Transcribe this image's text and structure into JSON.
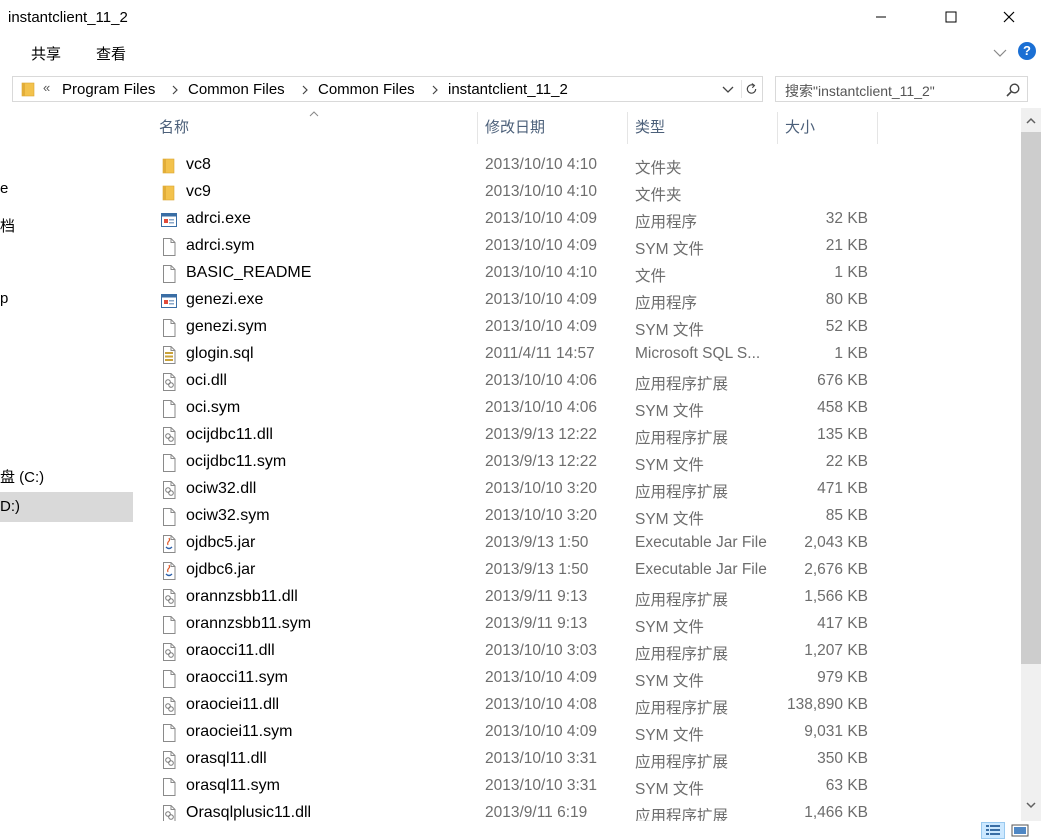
{
  "window": {
    "title": "instantclient_11_2",
    "minimize": "—",
    "maximize": "☐",
    "close": "✕"
  },
  "ribbon": {
    "tabs": [
      "共享",
      "查看"
    ],
    "help": "?"
  },
  "address": {
    "overflow": "«",
    "crumbs": [
      "Program Files",
      "Common Files",
      "Common Files",
      "instantclient_11_2"
    ]
  },
  "search": {
    "placeholder": "搜索\"instantclient_11_2\""
  },
  "nav": {
    "items": [
      "e",
      "档",
      "p",
      "盘 (C:)",
      "D:)"
    ]
  },
  "columns": {
    "name": "名称",
    "date": "修改日期",
    "type": "类型",
    "size": "大小"
  },
  "files": [
    {
      "icon": "folder",
      "name": "vc8",
      "date": "2013/10/10 4:10",
      "type": "文件夹",
      "size": ""
    },
    {
      "icon": "folder",
      "name": "vc9",
      "date": "2013/10/10 4:10",
      "type": "文件夹",
      "size": ""
    },
    {
      "icon": "exe",
      "name": "adrci.exe",
      "date": "2013/10/10 4:09",
      "type": "应用程序",
      "size": "32 KB"
    },
    {
      "icon": "file",
      "name": "adrci.sym",
      "date": "2013/10/10 4:09",
      "type": "SYM 文件",
      "size": "21 KB"
    },
    {
      "icon": "file",
      "name": "BASIC_README",
      "date": "2013/10/10 4:10",
      "type": "文件",
      "size": "1 KB"
    },
    {
      "icon": "exe",
      "name": "genezi.exe",
      "date": "2013/10/10 4:09",
      "type": "应用程序",
      "size": "80 KB"
    },
    {
      "icon": "file",
      "name": "genezi.sym",
      "date": "2013/10/10 4:09",
      "type": "SYM 文件",
      "size": "52 KB"
    },
    {
      "icon": "sql",
      "name": "glogin.sql",
      "date": "2011/4/11 14:57",
      "type": "Microsoft SQL S...",
      "size": "1 KB"
    },
    {
      "icon": "dll",
      "name": "oci.dll",
      "date": "2013/10/10 4:06",
      "type": "应用程序扩展",
      "size": "676 KB"
    },
    {
      "icon": "file",
      "name": "oci.sym",
      "date": "2013/10/10 4:06",
      "type": "SYM 文件",
      "size": "458 KB"
    },
    {
      "icon": "dll",
      "name": "ocijdbc11.dll",
      "date": "2013/9/13 12:22",
      "type": "应用程序扩展",
      "size": "135 KB"
    },
    {
      "icon": "file",
      "name": "ocijdbc11.sym",
      "date": "2013/9/13 12:22",
      "type": "SYM 文件",
      "size": "22 KB"
    },
    {
      "icon": "dll",
      "name": "ociw32.dll",
      "date": "2013/10/10 3:20",
      "type": "应用程序扩展",
      "size": "471 KB"
    },
    {
      "icon": "file",
      "name": "ociw32.sym",
      "date": "2013/10/10 3:20",
      "type": "SYM 文件",
      "size": "85 KB"
    },
    {
      "icon": "jar",
      "name": "ojdbc5.jar",
      "date": "2013/9/13 1:50",
      "type": "Executable Jar File",
      "size": "2,043 KB"
    },
    {
      "icon": "jar",
      "name": "ojdbc6.jar",
      "date": "2013/9/13 1:50",
      "type": "Executable Jar File",
      "size": "2,676 KB"
    },
    {
      "icon": "dll",
      "name": "orannzsbb11.dll",
      "date": "2013/9/11 9:13",
      "type": "应用程序扩展",
      "size": "1,566 KB"
    },
    {
      "icon": "file",
      "name": "orannzsbb11.sym",
      "date": "2013/9/11 9:13",
      "type": "SYM 文件",
      "size": "417 KB"
    },
    {
      "icon": "dll",
      "name": "oraocci11.dll",
      "date": "2013/10/10 3:03",
      "type": "应用程序扩展",
      "size": "1,207 KB"
    },
    {
      "icon": "file",
      "name": "oraocci11.sym",
      "date": "2013/10/10 4:09",
      "type": "SYM 文件",
      "size": "979 KB"
    },
    {
      "icon": "dll",
      "name": "oraociei11.dll",
      "date": "2013/10/10 4:08",
      "type": "应用程序扩展",
      "size": "138,890 KB"
    },
    {
      "icon": "file",
      "name": "oraociei11.sym",
      "date": "2013/10/10 4:09",
      "type": "SYM 文件",
      "size": "9,031 KB"
    },
    {
      "icon": "dll",
      "name": "orasql11.dll",
      "date": "2013/10/10 3:31",
      "type": "应用程序扩展",
      "size": "350 KB"
    },
    {
      "icon": "file",
      "name": "orasql11.sym",
      "date": "2013/10/10 3:31",
      "type": "SYM 文件",
      "size": "63 KB"
    },
    {
      "icon": "dll",
      "name": "Orasqlplusic11.dll",
      "date": "2013/9/11 6:19",
      "type": "应用程序扩展",
      "size": "1,466 KB"
    }
  ],
  "colors": {
    "selection": "#d9d9d9",
    "header_text": "#4c607a",
    "help_blue": "#1a6fd4",
    "folder_yellow": "#f3c24c"
  }
}
